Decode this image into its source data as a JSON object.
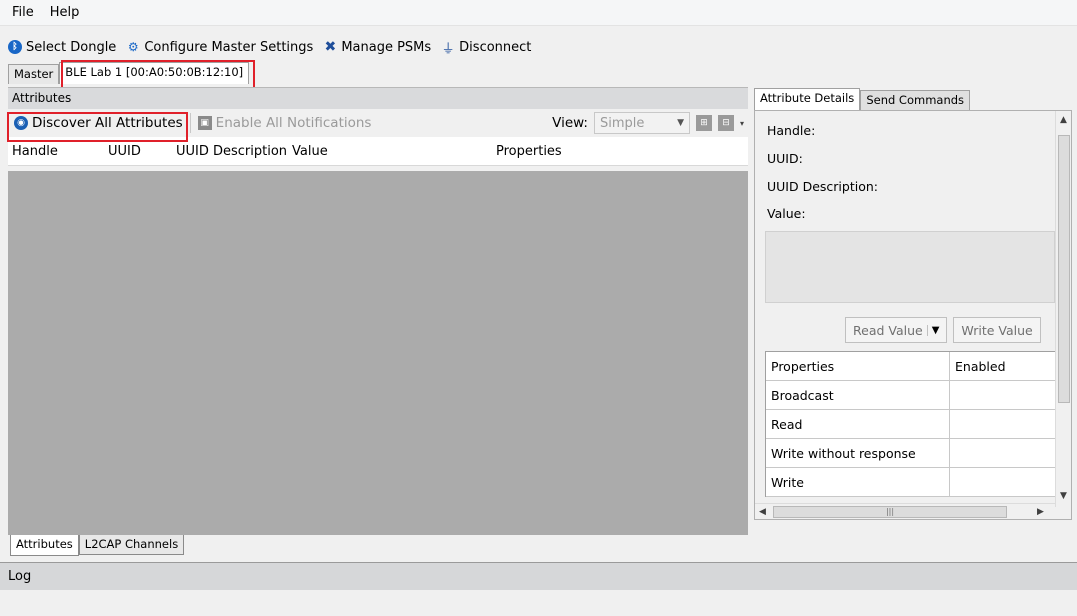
{
  "menu": {
    "file": "File",
    "help": "Help"
  },
  "toolbar": {
    "select_dongle": "Select Dongle",
    "configure_master": "Configure Master Settings",
    "manage_psms": "Manage PSMs",
    "disconnect": "Disconnect"
  },
  "top_tabs": {
    "master": "Master",
    "device": "BLE Lab 1 [00:A0:50:0B:12:10]"
  },
  "attributes_panel": {
    "title": "Attributes",
    "discover": "Discover All Attributes",
    "enable_notifications": "Enable All Notifications",
    "view_label": "View:",
    "view_value": "Simple",
    "columns": [
      "Handle",
      "UUID",
      "UUID Description",
      "Value",
      "Properties"
    ]
  },
  "bottom_tabs": {
    "attributes": "Attributes",
    "l2cap": "L2CAP Channels"
  },
  "right_panel": {
    "tabs": {
      "details": "Attribute Details",
      "commands": "Send Commands"
    },
    "fields": {
      "handle": "Handle:",
      "uuid": "UUID:",
      "uuid_desc": "UUID Description:",
      "value": "Value:"
    },
    "read_value": "Read Value",
    "write_value": "Write Value",
    "props_header": [
      "Properties",
      "Enabled"
    ],
    "props": [
      "Broadcast",
      "Read",
      "Write without response",
      "Write"
    ]
  },
  "log": {
    "title": "Log"
  },
  "colors": {
    "highlight": "#e0202a",
    "accent": "#1967c7"
  }
}
